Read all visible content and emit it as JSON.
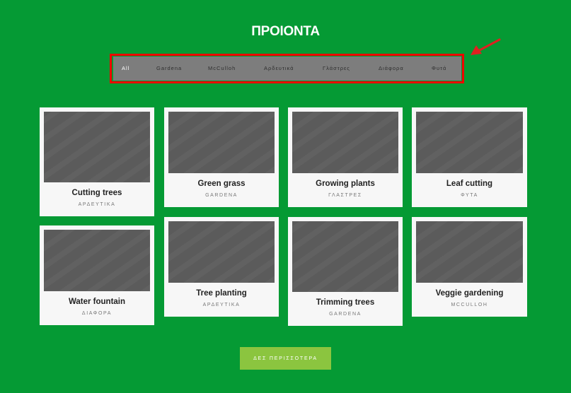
{
  "page": {
    "title": "ΠΡΟΙΟΝΤΑ"
  },
  "filters": [
    {
      "label": "All",
      "active": true
    },
    {
      "label": "Gardena",
      "active": false
    },
    {
      "label": "McCulloh",
      "active": false
    },
    {
      "label": "Αρδευτικά",
      "active": false
    },
    {
      "label": "Γλάστρες",
      "active": false
    },
    {
      "label": "Διάφορα",
      "active": false
    },
    {
      "label": "Φυτά",
      "active": false
    }
  ],
  "annotation": {
    "icon": "arrow-icon",
    "color": "#e02020",
    "outline_color": "#f00000"
  },
  "products": [
    {
      "name": "Cutting trees",
      "category": "ΑΡΔΕΥΤΙΚΑ"
    },
    {
      "name": "Green grass",
      "category": "GARDENA"
    },
    {
      "name": "Growing plants",
      "category": "ΓΛΑΣΤΡΕΣ"
    },
    {
      "name": "Leaf cutting",
      "category": "ΦΥΤΑ"
    },
    {
      "name": "Water fountain",
      "category": "ΔΙΑΦΟΡΑ"
    },
    {
      "name": "Tree planting",
      "category": "ΑΡΔΕΥΤΙΚΑ"
    },
    {
      "name": "Trimming trees",
      "category": "GARDENA"
    },
    {
      "name": "Veggie gardening",
      "category": "MCCULLOH"
    }
  ],
  "actions": {
    "more_label": "ΔΕΣ ΠΕΡΙΣΣΟΤΕΡΑ"
  },
  "colors": {
    "background": "#059a34",
    "filter_bar": "#7d7d7d",
    "card": "#f7f7f7",
    "thumbnail": "#5b5b5b",
    "button": "#8bc53f"
  }
}
